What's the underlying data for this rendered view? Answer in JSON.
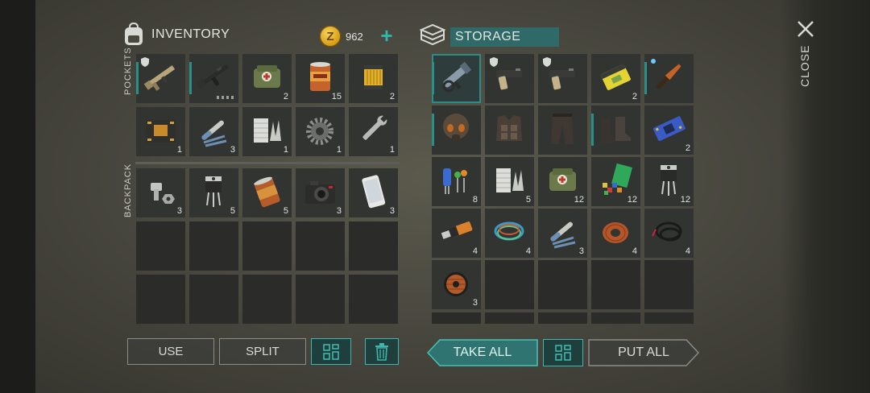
{
  "inventory": {
    "title": "INVENTORY",
    "coins": "962",
    "pockets_label": "POCKETS",
    "backpack_label": "BACKPACK"
  },
  "storage": {
    "title": "STORAGE"
  },
  "close_label": "CLOSE",
  "buttons": {
    "use": "USE",
    "split": "SPLIT",
    "take_all": "TAKE ALL",
    "put_all": "PUT ALL"
  },
  "colors": {
    "accent": "#2a8f89",
    "storage_bar": "#2f6a69",
    "coin": "#e0aa20"
  },
  "pockets": [
    {
      "item": "rifle-tan",
      "count": "",
      "accent": true,
      "shield": true
    },
    {
      "item": "assault-rifle",
      "count": "",
      "accent": true,
      "dots": true
    },
    {
      "item": "medkit-bag",
      "count": "2"
    },
    {
      "item": "canned-food",
      "count": "15"
    },
    {
      "item": "oil-filter",
      "count": "2"
    },
    {
      "item": "circuit-board",
      "count": "1"
    },
    {
      "item": "electrical-tools",
      "count": "3"
    },
    {
      "item": "duct-tape-fabric",
      "count": "1"
    },
    {
      "item": "gear",
      "count": "1"
    },
    {
      "item": "wrench",
      "count": "1"
    }
  ],
  "backpack": [
    {
      "item": "bolt-nut",
      "count": "3"
    },
    {
      "item": "transistor",
      "count": "5"
    },
    {
      "item": "rusty-can",
      "count": "5"
    },
    {
      "item": "camera",
      "count": "3"
    },
    {
      "item": "smartphone",
      "count": "3"
    }
  ],
  "storage_items": [
    {
      "item": "grenade-launcher",
      "count": "",
      "accent": true,
      "selected": true
    },
    {
      "item": "pistol",
      "count": "",
      "shield": true
    },
    {
      "item": "pistol",
      "count": "",
      "shield": true
    },
    {
      "item": "battery",
      "count": "2"
    },
    {
      "item": "knife",
      "count": "",
      "accent": true,
      "special": true
    },
    {
      "item": "gas-mask-helmet",
      "count": "",
      "accent": true
    },
    {
      "item": "body-armor",
      "count": ""
    },
    {
      "item": "pants",
      "count": ""
    },
    {
      "item": "boots",
      "count": "",
      "accent": true
    },
    {
      "item": "circuit-chip",
      "count": "2"
    },
    {
      "item": "electronic-parts",
      "count": "8"
    },
    {
      "item": "duct-tape-fabric",
      "count": "5"
    },
    {
      "item": "medkit-bag",
      "count": "12"
    },
    {
      "item": "plastic-pieces",
      "count": "12"
    },
    {
      "item": "transistor",
      "count": "12"
    },
    {
      "item": "usb-stick",
      "count": "4"
    },
    {
      "item": "wires",
      "count": "4"
    },
    {
      "item": "electrical-tools",
      "count": "3"
    },
    {
      "item": "copper-coil",
      "count": "4"
    },
    {
      "item": "black-cable",
      "count": "4"
    },
    {
      "item": "copper-wire-spool",
      "count": "3"
    }
  ]
}
